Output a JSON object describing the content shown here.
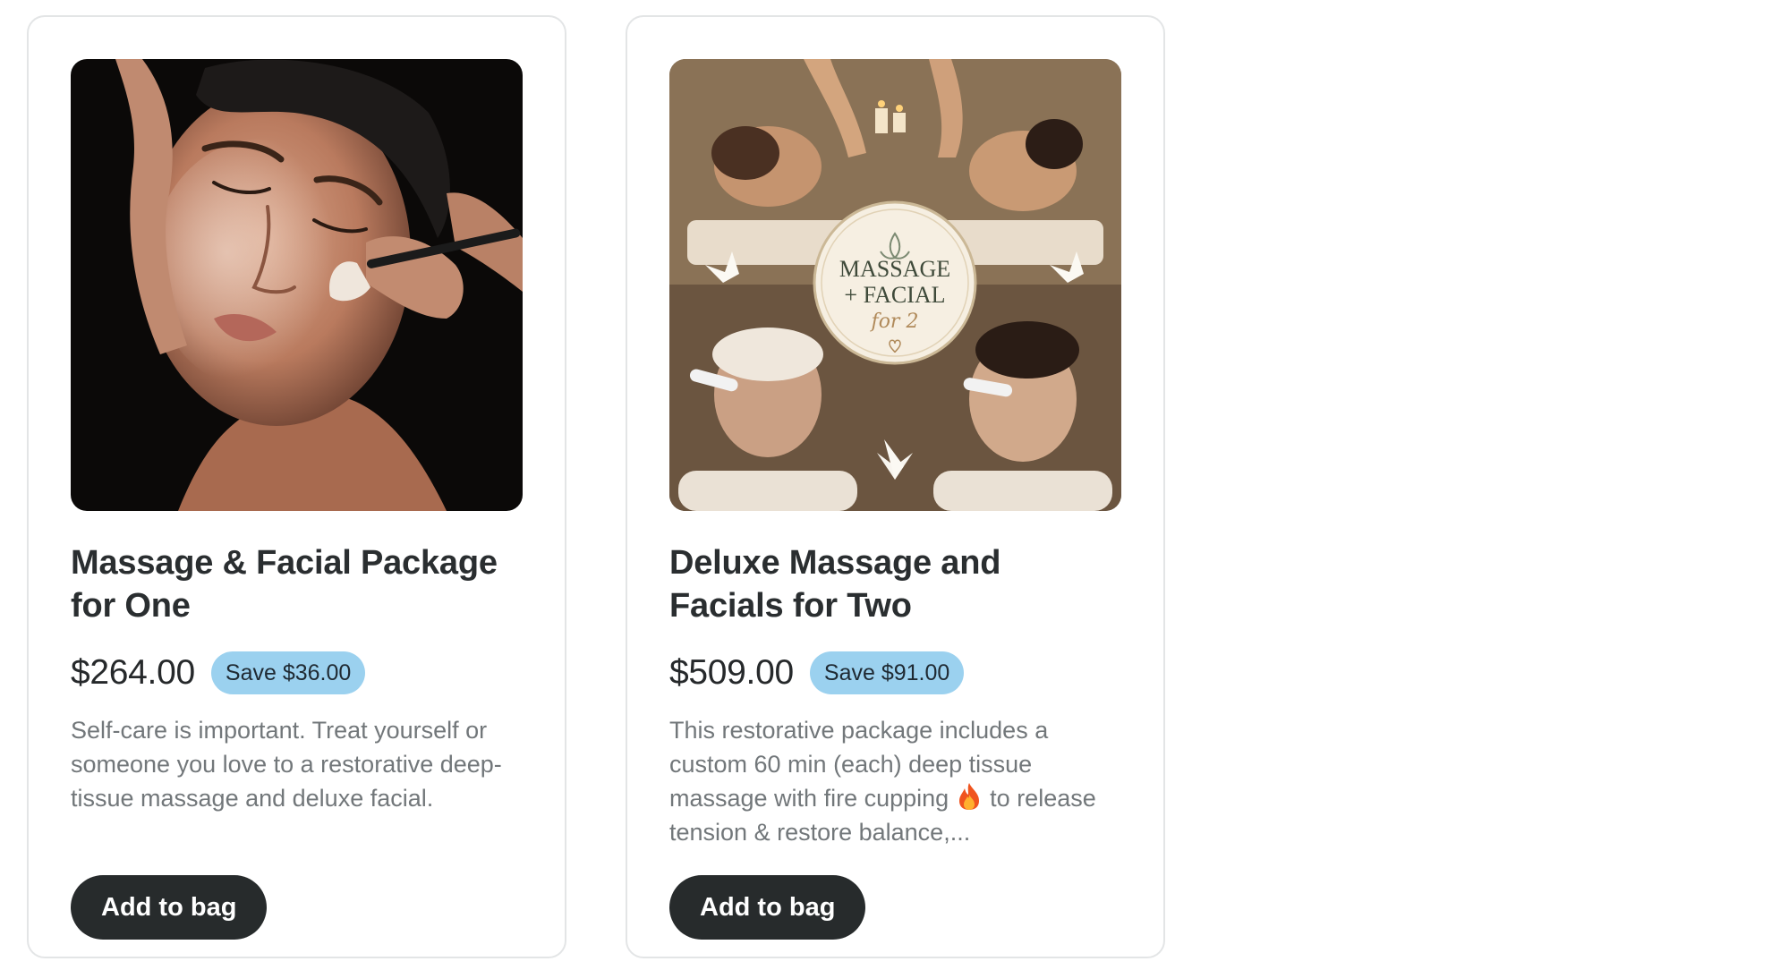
{
  "products": [
    {
      "title": "Massage & Facial Package for One",
      "price": "$264.00",
      "badge": "Save $36.00",
      "description": "Self-care is important. Treat yourself or someone you love to a restorative deep-tissue massage and deluxe facial.",
      "button_label": "Add to bag",
      "image_alt": "woman receiving a facial treatment with a brush"
    },
    {
      "title": "Deluxe Massage and Facials for Two",
      "price": "$509.00",
      "badge": "Save $91.00",
      "description_before_icon": "This restorative package includes a custom 60 min (each) deep tissue massage with fire cupping",
      "description_icon": "fire-emoji-icon",
      "description_after_icon": "to release tension & restore balance,...",
      "button_label": "Add to bag",
      "image_alt": "collage of two couples receiving massages and facials",
      "image_badge": {
        "line1": "MASSAGE",
        "line2": "+ FACIAL",
        "line3": "for 2"
      }
    }
  ],
  "colors": {
    "badge_bg": "#9bd1ef",
    "button_bg": "#272b2c",
    "card_border": "#e3e5e6",
    "description_text": "#72777a"
  }
}
